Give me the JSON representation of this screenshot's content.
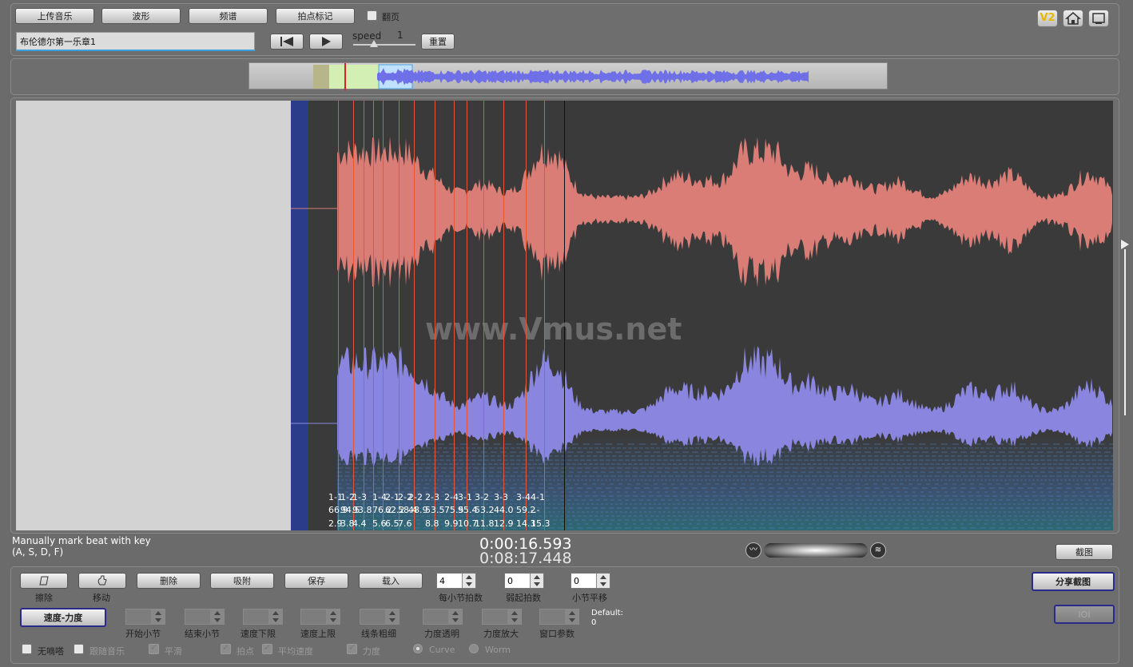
{
  "toolbar": {
    "upload_music": "上传音乐",
    "waveform": "波形",
    "spectrum": "频谱",
    "beat_mark": "拍点标记",
    "page_flip": "翻页",
    "track_name": "布伦德尔第一乐章1",
    "speed_label": "speed",
    "speed_value": "1",
    "reset": "重置",
    "v2_badge": "V2"
  },
  "canvas": {
    "watermark": "www.Vmus.net",
    "beat_labels": [
      {
        "a": "1-1",
        "b": "66.9",
        "c": "2.9"
      },
      {
        "a": "1-2",
        "b": "94.5",
        "c": "3.8"
      },
      {
        "a": "1-3",
        "b": "93.8",
        "c": "4.4"
      },
      {
        "a": "1-4",
        "b": "76.2",
        "c": "5.6"
      },
      {
        "a": "2-1",
        "b": "62.2",
        "c": "6.5"
      },
      {
        "a": "2-2",
        "b": "58.4",
        "c": "7.6"
      },
      {
        "a": "2-2",
        "b": "48.9",
        "c": ""
      },
      {
        "a": "2-3",
        "b": "53.5",
        "c": "8.8"
      },
      {
        "a": "2-4",
        "b": "75.5",
        "c": "9.9"
      },
      {
        "a": "3-1",
        "b": "95.4",
        "c": "10.7"
      },
      {
        "a": "3-2",
        "b": "53.2",
        "c": "11.8"
      },
      {
        "a": "3-3",
        "b": "44.0",
        "c": "12.9"
      },
      {
        "a": "3-4",
        "b": "59.2",
        "c": "14.3"
      },
      {
        "a": "4-1",
        "b": "-.-",
        "c": "15.3"
      }
    ]
  },
  "status": {
    "hint_line1": "Manually mark beat with key",
    "hint_line2": "(A, S, D, F)",
    "current_time": "0:00:16.593",
    "total_time": "0:08:17.448",
    "screenshot": "截图"
  },
  "controls": {
    "erase": "擦除",
    "move": "移动",
    "delete": "删除",
    "snap": "吸附",
    "save": "保存",
    "load": "载入",
    "beats_per_bar_value": "4",
    "beats_per_bar_label": "每小节拍数",
    "pickup_value": "0",
    "pickup_label": "弱起拍数",
    "bar_offset_value": "0",
    "bar_offset_label": "小节平移",
    "share_screenshot": "分享截图",
    "tempo_dynamics": "速度-力度",
    "start_bar": "开始小节",
    "end_bar": "结束小节",
    "tempo_min": "速度下限",
    "tempo_max": "速度上限",
    "line_width": "线条粗细",
    "dyn_transparency": "力度透明",
    "dyn_zoom": "力度放大",
    "window_param": "窗口参数",
    "default_label": "Default:",
    "default_value": "0",
    "ioi": "IOI",
    "no_beep": "无嘀嗒",
    "follow_music": "跟随音乐",
    "smooth": "平滑",
    "beat_point": "拍点",
    "avg_tempo": "平均速度",
    "dynamics": "力度",
    "curve": "Curve",
    "worm": "Worm"
  },
  "colors": {
    "waveform_top": "#d97d76",
    "waveform_bottom": "#8a86e0",
    "beat_line": "#e0583a",
    "canvas_bg": "#3a3a3a"
  }
}
